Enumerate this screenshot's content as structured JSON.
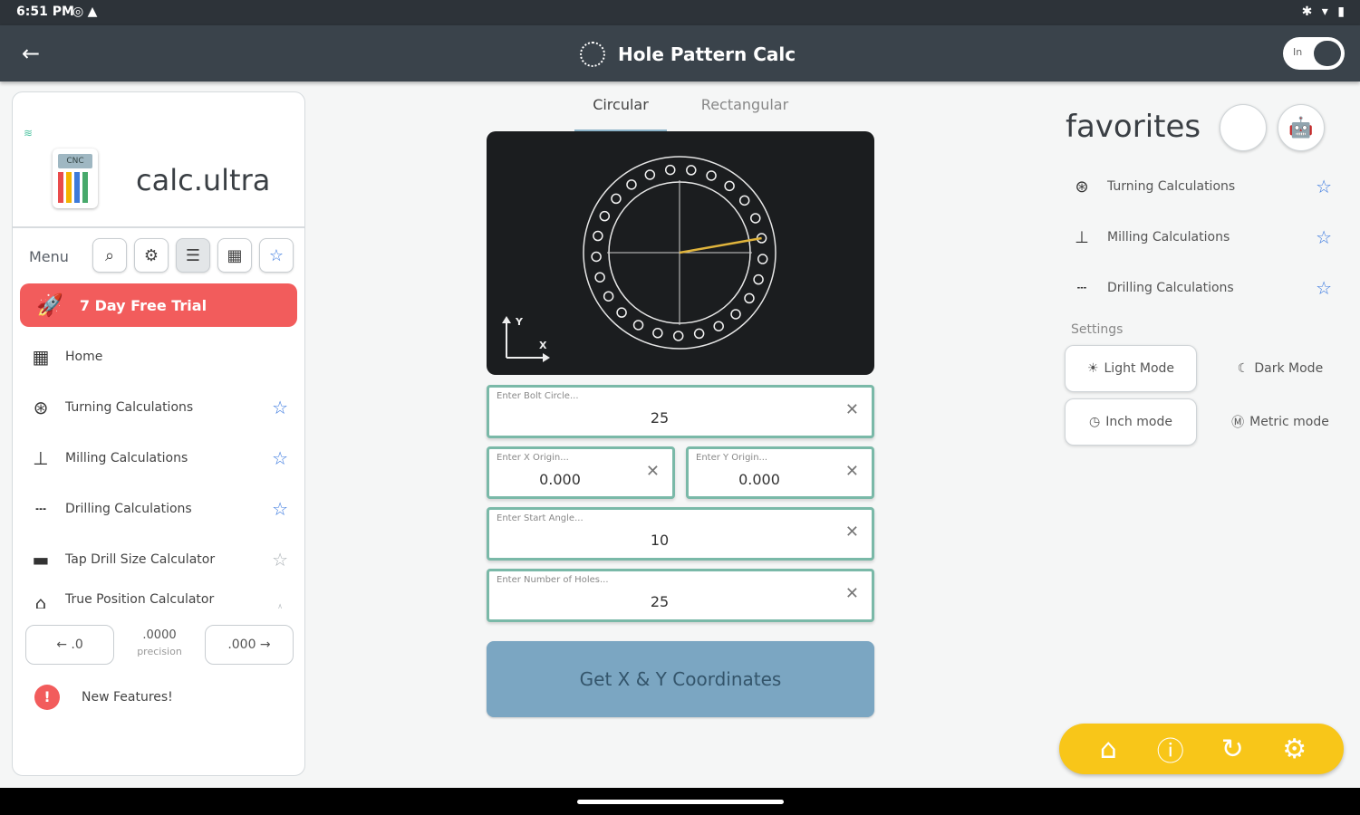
{
  "status_bar": {
    "time": "6:51 PM",
    "left_icons": "◎ ▲",
    "right_icons": "✱ ▾ ▮"
  },
  "app_bar": {
    "title": "Hole Pattern Calc",
    "toggle_label": "In"
  },
  "left_panel": {
    "brand": "calc.ultra",
    "calc_logo_text": "CNC",
    "menu_label": "Menu",
    "trial_label": "7 Day Free Trial",
    "nav_items": [
      {
        "label": "Home",
        "icon": "calculator-icon",
        "glyph": "▦"
      },
      {
        "label": "Turning Calculations",
        "icon": "lathe-chuck-icon",
        "glyph": "⊛",
        "starred": true
      },
      {
        "label": "Milling Calculations",
        "icon": "mill-icon",
        "glyph": "⊥",
        "starred": true
      },
      {
        "label": "Drilling Calculations",
        "icon": "drill-icon",
        "glyph": "┄",
        "starred": true
      },
      {
        "label": "Tap Drill Size Calculator",
        "icon": "tap-icon",
        "glyph": "▬",
        "starred": false
      },
      {
        "label": "True Position Calculator",
        "icon": "true-position-icon",
        "glyph": "⌂",
        "starred": false
      }
    ],
    "precision": {
      "left": "← .0",
      "value": ".0000",
      "label": "precision",
      "right": ".000 →"
    },
    "new_features": "New Features!"
  },
  "tabs": [
    {
      "label": "Circular",
      "active": true
    },
    {
      "label": "Rectangular",
      "active": false
    }
  ],
  "canvas": {
    "holes": 25,
    "start_angle_deg": 10,
    "axis_y": "Y",
    "axis_x": "X"
  },
  "fields": {
    "bolt_circle": {
      "placeholder": "Enter Bolt Circle...",
      "value": "25"
    },
    "x_origin": {
      "placeholder": "Enter X Origin...",
      "value": "0.000"
    },
    "y_origin": {
      "placeholder": "Enter Y Origin...",
      "value": "0.000"
    },
    "start_angle": {
      "placeholder": "Enter Start Angle...",
      "value": "10"
    },
    "num_holes": {
      "placeholder": "Enter Number of Holes...",
      "value": "25"
    }
  },
  "get_button": "Get X & Y Coordinates",
  "favorites": {
    "title": "favorites",
    "items": [
      {
        "label": "Turning Calculations",
        "glyph": "⊛"
      },
      {
        "label": "Milling Calculations",
        "glyph": "⊥"
      },
      {
        "label": "Drilling Calculations",
        "glyph": "┄"
      }
    ]
  },
  "settings": {
    "label": "Settings",
    "light_mode": "Light Mode",
    "dark_mode": "Dark Mode",
    "inch_mode": "Inch mode",
    "metric_mode": "Metric mode"
  },
  "colors": {
    "accent_red": "#f25c5c",
    "accent_yellow": "#f8c619",
    "accent_blue": "#3d7be0",
    "field_border": "#7ab9a8",
    "button_blue": "#7ba6c2",
    "radius_line": "#e0b43c"
  }
}
